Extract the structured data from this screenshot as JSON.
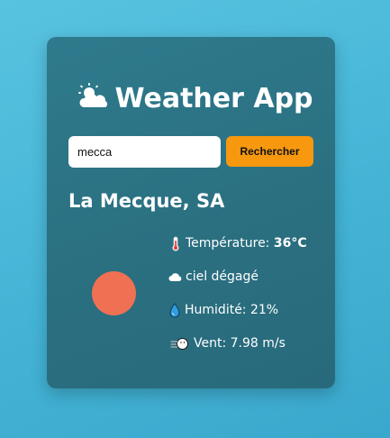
{
  "app": {
    "title": "Weather App",
    "title_icon": "sun-behind-cloud-icon"
  },
  "search": {
    "value": "mecca",
    "placeholder": "",
    "button_label": "Rechercher"
  },
  "result": {
    "city": "La Mecque, SA",
    "weather_icon": "sun-icon",
    "temperature_label": "Température:",
    "temperature_value": "36°C",
    "temperature_icon": "thermometer-icon",
    "description": "ciel dégagé",
    "description_icon": "cloud-icon",
    "humidity": "Humidité: 21%",
    "humidity_icon": "droplet-icon",
    "wind": "Vent: 7.98 m/s",
    "wind_icon": "wind-face-icon"
  },
  "colors": {
    "background": "#4db9dc",
    "card": "#2b7284",
    "button": "#f7980f",
    "sun": "#ef7052"
  }
}
